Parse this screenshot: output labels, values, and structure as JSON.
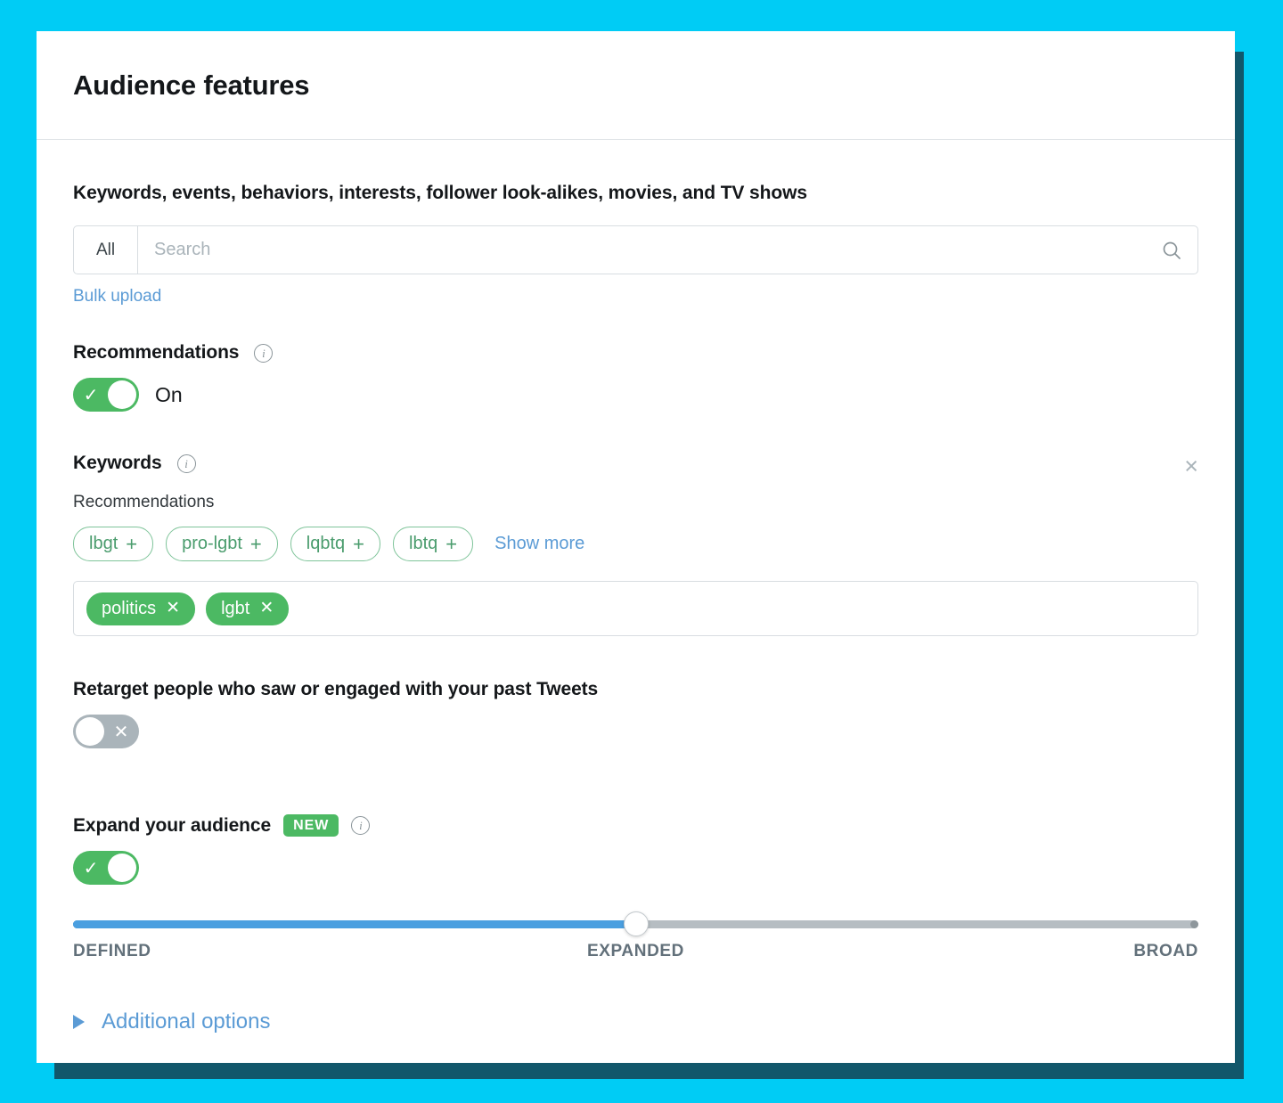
{
  "card": {
    "title": "Audience features"
  },
  "search_section": {
    "heading": "Keywords, events, behaviors, interests, follower look-alikes, movies, and TV shows",
    "scope_label": "All",
    "search_placeholder": "Search",
    "search_value": "",
    "search_icon": "search-icon",
    "bulk_upload_label": "Bulk upload"
  },
  "recommendations": {
    "heading": "Recommendations",
    "info_icon": "info-icon",
    "toggle_state": "on",
    "toggle_label": "On",
    "toggle_mark": "✓"
  },
  "keywords": {
    "heading": "Keywords",
    "info_icon": "info-icon",
    "remove_icon": "×",
    "recommendations_label": "Recommendations",
    "suggestions": [
      {
        "label": "lbgt",
        "add_icon": "+"
      },
      {
        "label": "pro-lgbt",
        "add_icon": "+"
      },
      {
        "label": "lqbtq",
        "add_icon": "+"
      },
      {
        "label": "lbtq",
        "add_icon": "+"
      }
    ],
    "show_more_label": "Show more",
    "selected": [
      {
        "label": "politics",
        "remove_icon": "✕"
      },
      {
        "label": "lgbt",
        "remove_icon": "✕"
      }
    ]
  },
  "retarget": {
    "heading": "Retarget people who saw or engaged with your past Tweets",
    "toggle_state": "off",
    "toggle_mark": "✕"
  },
  "expand_audience": {
    "heading": "Expand your audience",
    "badge": "NEW",
    "info_icon": "info-icon",
    "toggle_state": "on",
    "toggle_mark": "✓",
    "slider": {
      "value_percent": 50,
      "labels": {
        "min": "DEFINED",
        "mid": "EXPANDED",
        "max": "BROAD"
      }
    }
  },
  "additional_options": {
    "label": "Additional options",
    "disclosure_icon": "triangle-right-icon"
  },
  "colors": {
    "background": "#00ccf5",
    "card_shadow": "#11576b",
    "green": "#4cb963",
    "link_blue": "#5b9bd5",
    "slider_blue": "#4a9fe0",
    "slider_grey": "#b6bdc2"
  }
}
